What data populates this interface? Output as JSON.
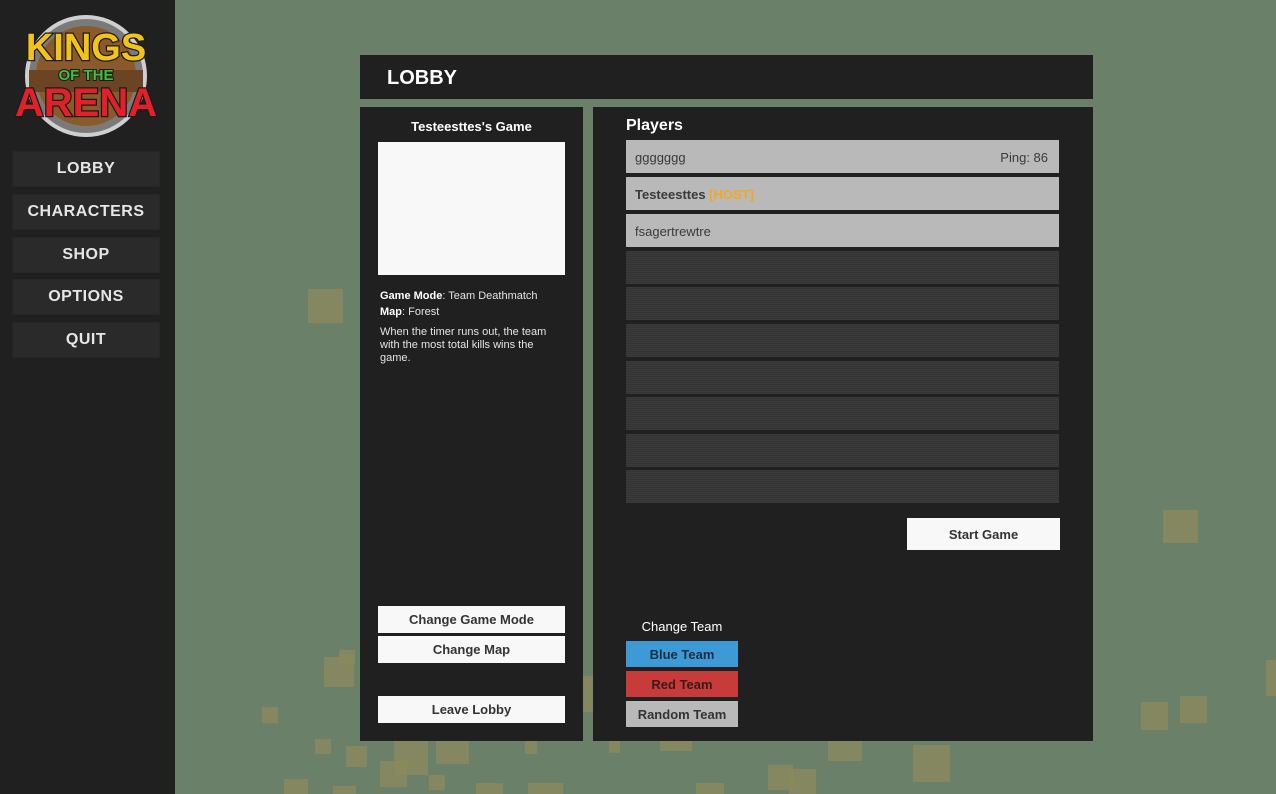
{
  "logo": {
    "line1": "KINGS",
    "line2": "OF THE",
    "line3": "ARENA"
  },
  "sidebar": {
    "items": [
      {
        "label": "LOBBY"
      },
      {
        "label": "CHARACTERS"
      },
      {
        "label": "SHOP"
      },
      {
        "label": "OPTIONS"
      },
      {
        "label": "QUIT"
      }
    ]
  },
  "header": {
    "title": "LOBBY"
  },
  "game": {
    "title": "Testeesttes's Game",
    "mode_label": "Game Mode",
    "mode_value": ": Team Deathmatch",
    "map_label": "Map",
    "map_value": ": Forest",
    "description": "When the timer runs out, the team with the most total kills wins the game.",
    "change_mode_label": "Change Game Mode",
    "change_map_label": "Change Map",
    "leave_label": "Leave Lobby"
  },
  "players": {
    "heading": "Players",
    "list": [
      {
        "name": "ggggggg",
        "ping": "Ping: 86"
      },
      {
        "name": "Testeesttes",
        "tag": "[HOST]"
      },
      {
        "name": "fsagertrewtre"
      }
    ],
    "start_label": "Start Game"
  },
  "team": {
    "label": "Change Team",
    "blue_label": "Blue Team",
    "red_label": "Red Team",
    "random_label": "Random Team"
  },
  "colors": {
    "blue_team": "#3d9ad6",
    "red_team": "#c83b3b",
    "random_team": "#b9b9b9",
    "host_tag": "#f5a623",
    "background": "#6b8068"
  }
}
